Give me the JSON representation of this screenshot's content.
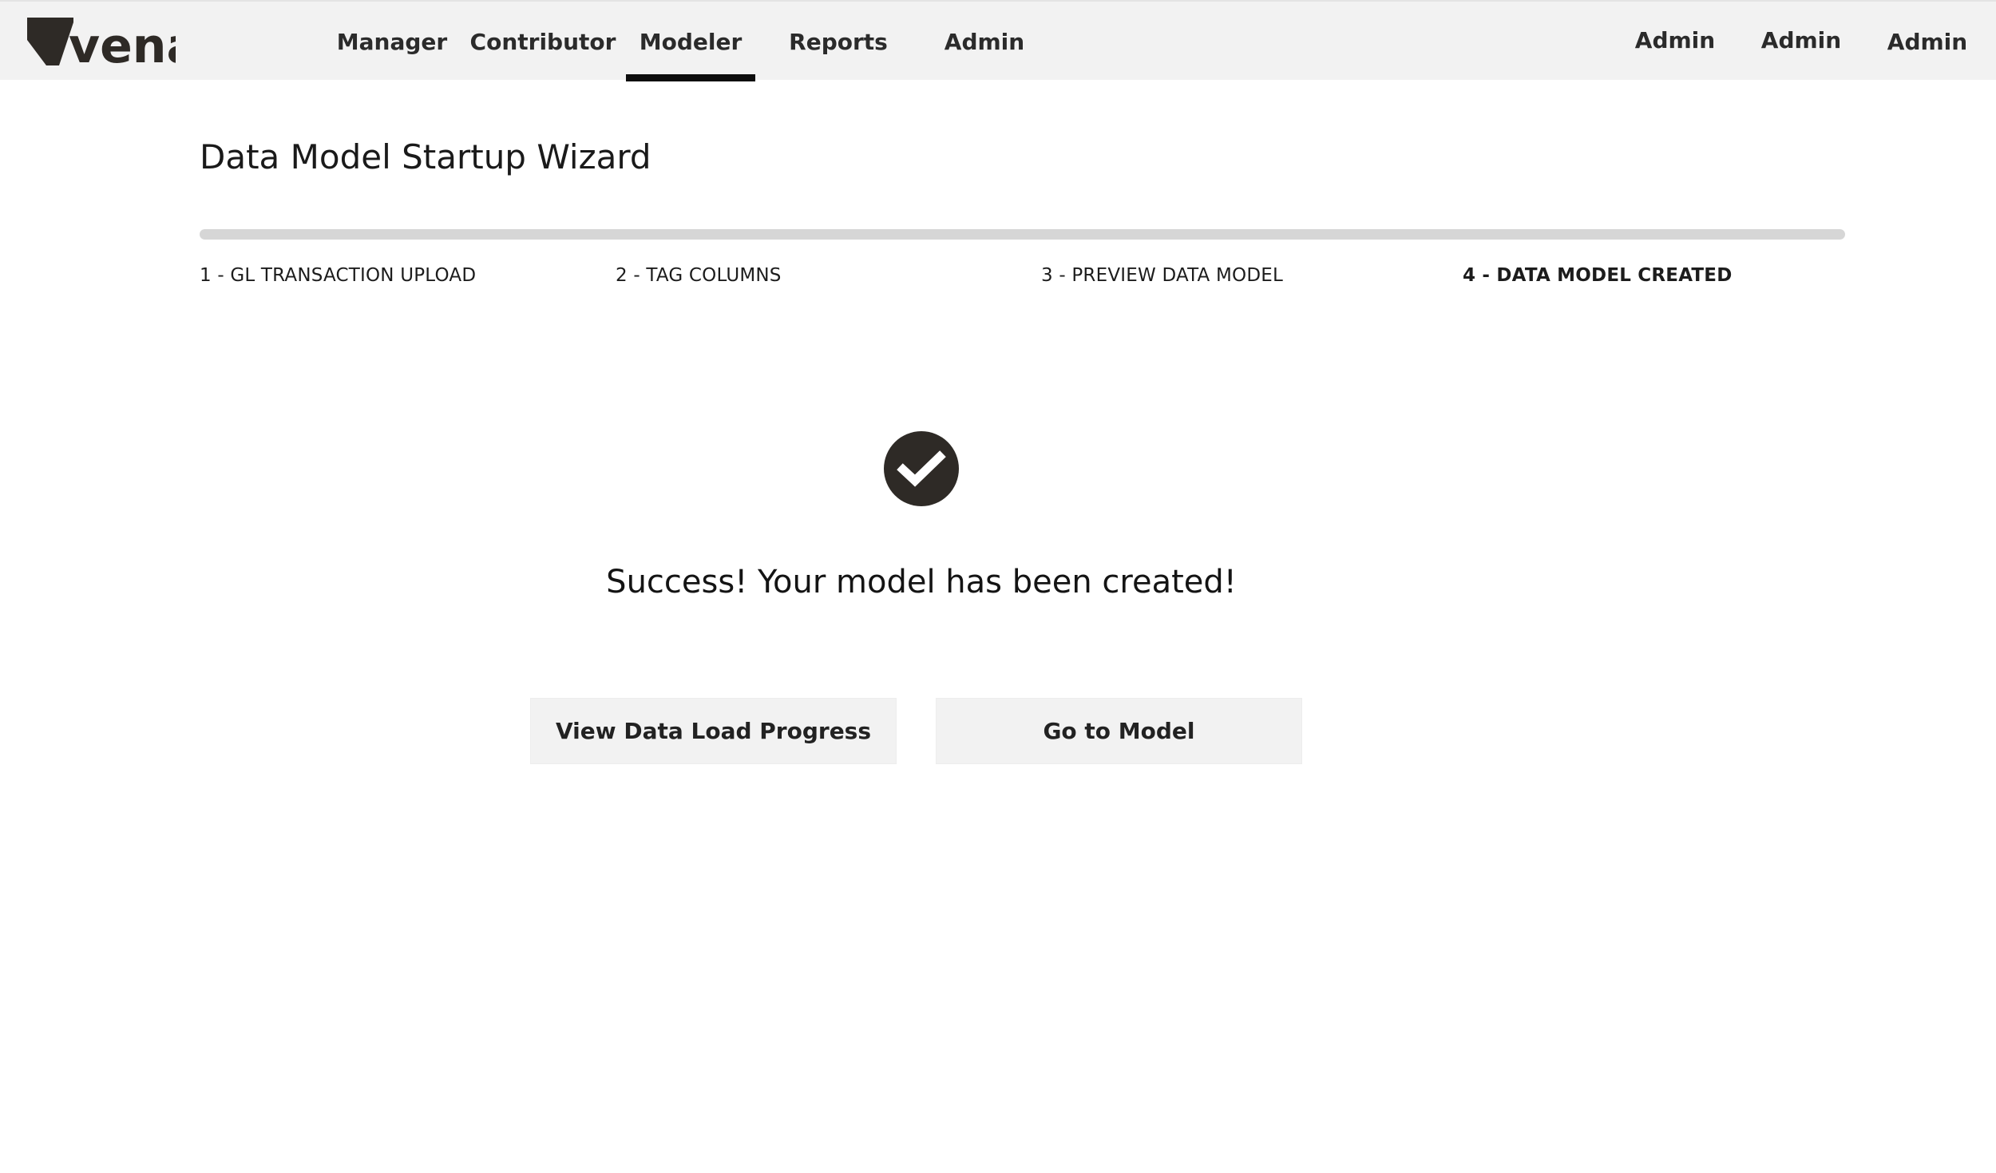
{
  "brand": {
    "logo_text": "vena",
    "colors": {
      "topbar": "#f2f2f2",
      "logo": "#2e2a26",
      "active_indicator": "#0d0d0d",
      "progress_track": "#d6d6d6",
      "success_icon": "#2e2a26",
      "button_bg": "#f2f2f2"
    }
  },
  "nav": {
    "items": [
      {
        "label": "Manager",
        "active": false
      },
      {
        "label": "Contributor",
        "active": false
      },
      {
        "label": "Modeler",
        "active": true
      },
      {
        "label": "Reports",
        "active": false
      },
      {
        "label": "Admin",
        "active": false
      }
    ],
    "right_items": [
      {
        "label": "Admin"
      },
      {
        "label": "Admin"
      },
      {
        "label": "Admin"
      }
    ]
  },
  "wizard": {
    "title": "Data Model Startup Wizard",
    "progress": 1.0,
    "steps": [
      {
        "label": "1 - GL TRANSACTION UPLOAD",
        "current": false
      },
      {
        "label": "2 - TAG COLUMNS",
        "current": false
      },
      {
        "label": "3 - PREVIEW DATA MODEL",
        "current": false
      },
      {
        "label": "4 - DATA MODEL CREATED",
        "current": true
      }
    ],
    "success_icon": "check-circle-icon",
    "success_message": "Success! Your model has been created!",
    "buttons": {
      "view_progress": "View Data Load Progress",
      "go_to_model": "Go to Model"
    }
  }
}
